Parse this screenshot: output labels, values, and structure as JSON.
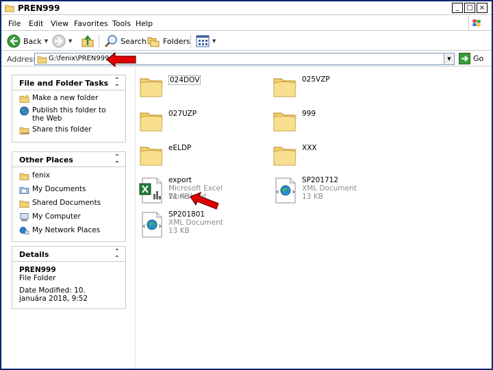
{
  "window": {
    "title": "PREN999",
    "controls": {
      "minimize": "_",
      "maximize": "□",
      "close": "×"
    }
  },
  "menu": [
    "File",
    "Edit",
    "View",
    "Favorites",
    "Tools",
    "Help"
  ],
  "toolbar": {
    "back_label": "Back",
    "search_label": "Search",
    "folders_label": "Folders"
  },
  "address": {
    "label": "Address",
    "value": "G:\\fenix\\PREN999",
    "go_label": "Go"
  },
  "sidebar": {
    "file_tasks": {
      "title": "File and Folder Tasks",
      "items": [
        {
          "label": "Make a new folder",
          "icon": "new-folder-icon"
        },
        {
          "label": "Publish this folder to the Web",
          "icon": "globe-icon"
        },
        {
          "label": "Share this folder",
          "icon": "share-folder-icon"
        }
      ]
    },
    "other_places": {
      "title": "Other Places",
      "items": [
        {
          "label": "fenix",
          "icon": "folder-icon"
        },
        {
          "label": "My Documents",
          "icon": "documents-icon"
        },
        {
          "label": "Shared Documents",
          "icon": "shared-folder-icon"
        },
        {
          "label": "My Computer",
          "icon": "computer-icon"
        },
        {
          "label": "My Network Places",
          "icon": "network-icon"
        }
      ]
    },
    "details": {
      "title": "Details",
      "name": "PREN999",
      "kind": "File Folder",
      "modified": "Date Modified: 10. januára 2018, 9:52"
    }
  },
  "files": [
    {
      "name": "024DOV",
      "kind": "folder"
    },
    {
      "name": "025VZP",
      "kind": "folder"
    },
    {
      "name": "027UZP",
      "kind": "folder"
    },
    {
      "name": "999",
      "kind": "folder"
    },
    {
      "name": "eELDP",
      "kind": "folder"
    },
    {
      "name": "XXX",
      "kind": "folder"
    },
    {
      "name": "export",
      "kind": "excel",
      "type": "Microsoft Excel Worksheet",
      "size": "11 KB"
    },
    {
      "name": "SP201712",
      "kind": "xml",
      "type": "XML Document",
      "size": "13 KB"
    },
    {
      "name": "SP201801",
      "kind": "xml",
      "type": "XML Document",
      "size": "13 KB"
    }
  ],
  "colors": {
    "arrow": "#e00000",
    "folder": "#f5d97a",
    "title_border": "#0a246a"
  }
}
